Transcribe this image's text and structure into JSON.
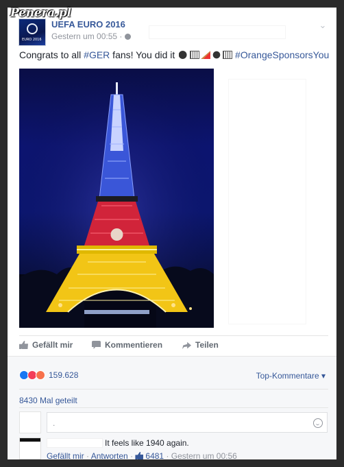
{
  "watermark": "Penera.pl",
  "header": {
    "page_name": "UEFA EURO 2016",
    "timestamp": "Gestern um 00:55 ·",
    "avatar_text": "EURO 2016"
  },
  "post": {
    "text_before": "Congrats to all ",
    "tag1": "#GER",
    "text_middle": " fans! You did it ",
    "tag2": "#OrangeSponsorsYou"
  },
  "actions": {
    "like": "Gefällt mir",
    "comment": "Kommentieren",
    "share": "Teilen"
  },
  "stats": {
    "reaction_count": "159.628",
    "top_comments": "Top-Kommentare ▾",
    "shares": "8430 Mal geteilt"
  },
  "comment_box": {
    "placeholder": "."
  },
  "reply": {
    "text": "It feels like 1940 again.",
    "like": "Gefällt mir",
    "reply": "Antworten",
    "likes": "6481",
    "time": "Gestern um 00:56"
  },
  "colors": {
    "link": "#365899",
    "german_black": "#111111",
    "german_red": "#e3263b",
    "german_gold": "#f5c518"
  }
}
